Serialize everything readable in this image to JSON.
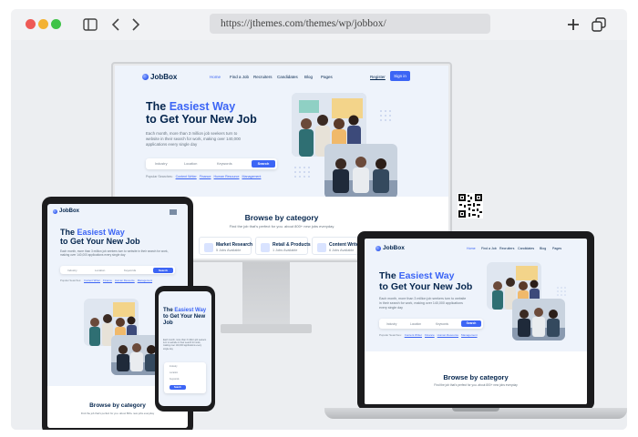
{
  "browser": {
    "url": "https://jthemes.com/themes/wp/jobbox/",
    "icons": [
      "sidebar-icon",
      "back-icon",
      "forward-icon",
      "new-tab-icon",
      "tabs-overview-icon"
    ]
  },
  "site": {
    "logo": "JobBox",
    "nav": [
      "Home",
      "Find a Job",
      "Recruiters",
      "Candidates",
      "Blog",
      "Pages"
    ],
    "register": "Register",
    "signin": "Sign in",
    "hero": {
      "title_prefix": "The ",
      "title_accent": "Easiest Way",
      "title_line2": "to Get Your New Job",
      "subtitle": "Each month, more than 3 million job seekers turn to website in their search for work, making over 140,000 applications every single day"
    },
    "search": {
      "industry": "Industry",
      "location": "Location",
      "keyword": "Keywords",
      "button": "Search"
    },
    "popular": {
      "label": "Popular Searches:",
      "tags": [
        "Content Writer",
        "Finance",
        "Human Resource",
        "Management"
      ]
    },
    "browse": {
      "title": "Browse by category",
      "subtitle": "Find the job that’s perfect for you. about 800+ new jobs everyday"
    },
    "categories": [
      {
        "title": "Market Research",
        "sub": "5 Jobs Available"
      },
      {
        "title": "Retail & Products",
        "sub": "1 Jobs Available"
      },
      {
        "title": "Content Writer",
        "sub": "6 Jobs Available"
      }
    ]
  },
  "colors": {
    "accent": "#3c65f5",
    "navy": "#05264e",
    "page_bg": "#eef3fb"
  }
}
